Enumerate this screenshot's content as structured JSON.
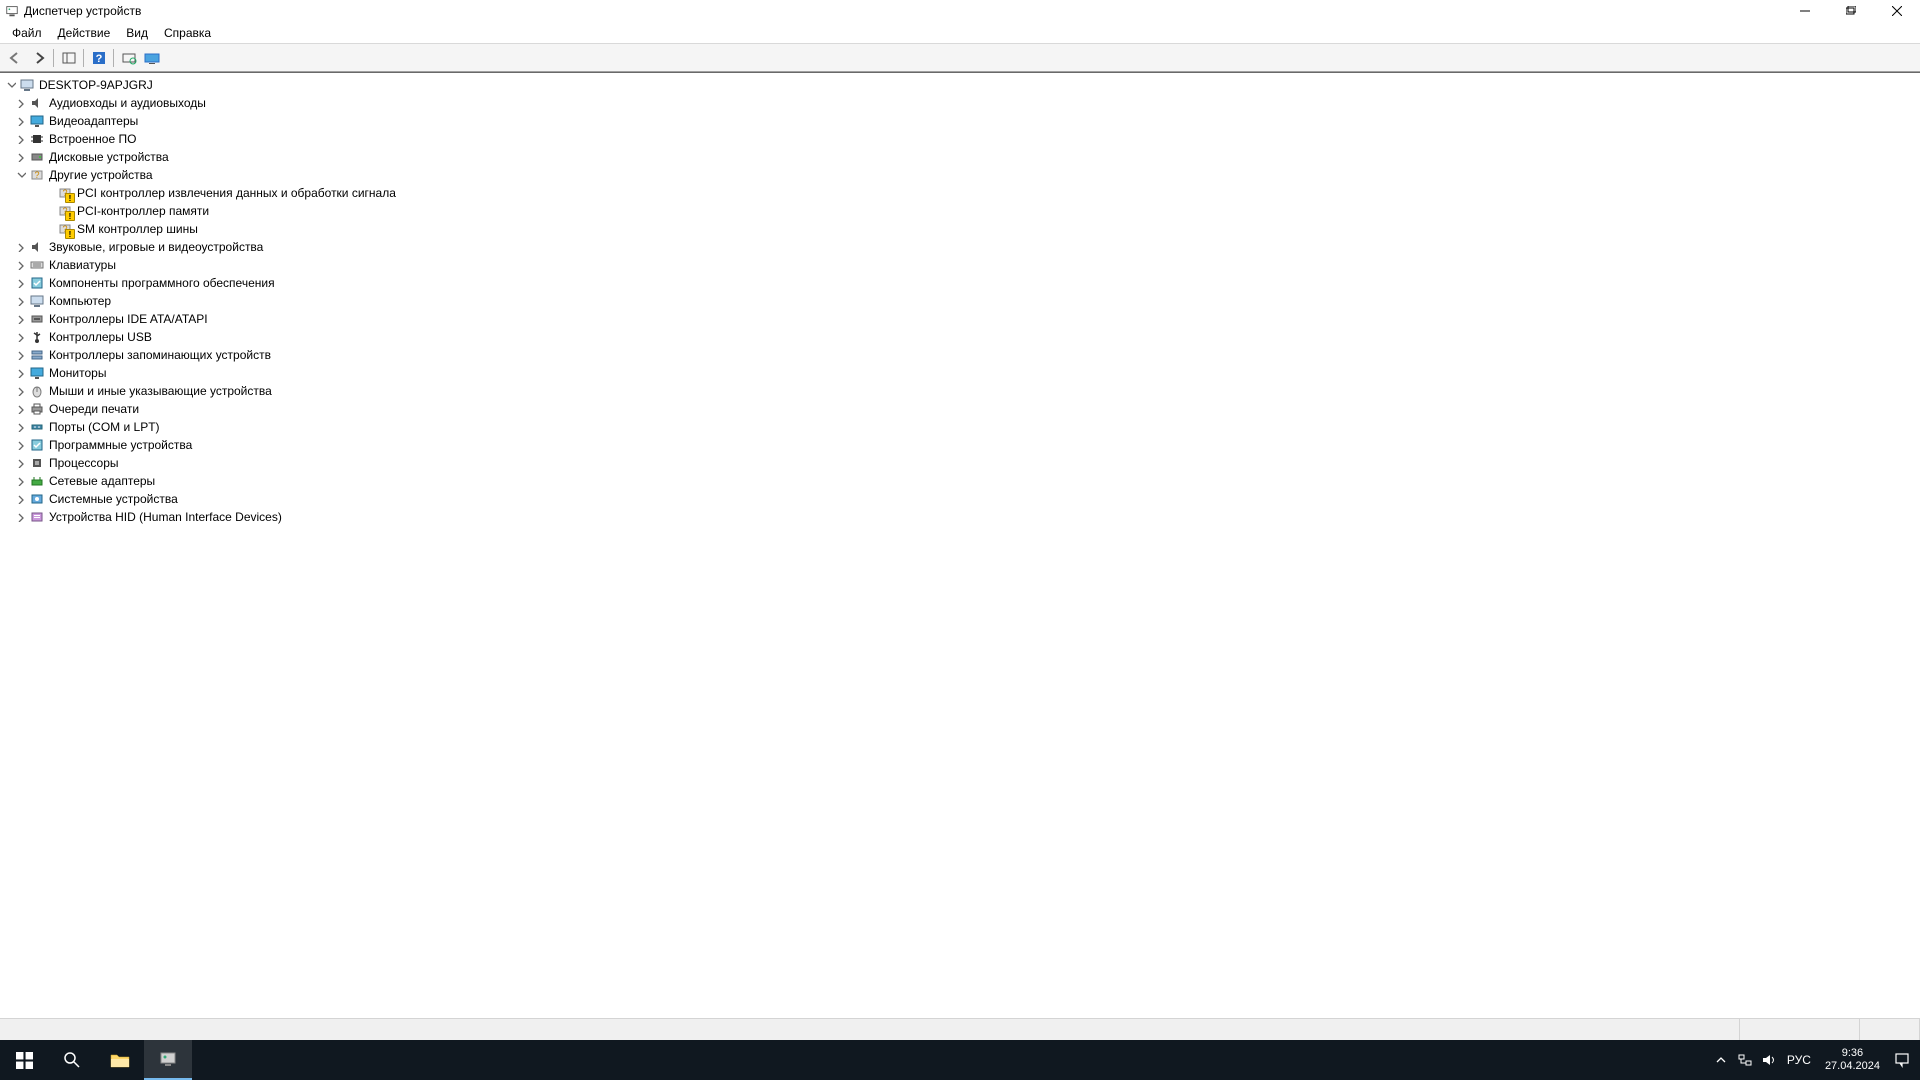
{
  "title": "Диспетчер устройств",
  "menu": {
    "file": "Файл",
    "action": "Действие",
    "view": "Вид",
    "help": "Справка"
  },
  "tree": {
    "root": {
      "label": "DESKTOP-9APJGRJ",
      "expanded": true
    },
    "categories": [
      {
        "id": "audio",
        "label": "Аудиовходы и аудиовыходы",
        "expanded": false,
        "icon": "audio"
      },
      {
        "id": "display",
        "label": "Видеоадаптеры",
        "expanded": false,
        "icon": "monitor"
      },
      {
        "id": "firmware",
        "label": "Встроенное ПО",
        "expanded": false,
        "icon": "chip"
      },
      {
        "id": "disk",
        "label": "Дисковые устройства",
        "expanded": false,
        "icon": "disk"
      },
      {
        "id": "other",
        "label": "Другие устройства",
        "expanded": true,
        "icon": "other",
        "children": [
          {
            "label": "PCI контроллер извлечения данных и обработки сигнала",
            "warning": true
          },
          {
            "label": "PCI-контроллер памяти",
            "warning": true
          },
          {
            "label": "SM контроллер шины",
            "warning": true
          }
        ]
      },
      {
        "id": "sound",
        "label": "Звуковые, игровые и видеоустройства",
        "expanded": false,
        "icon": "audio"
      },
      {
        "id": "keyboard",
        "label": "Клавиатуры",
        "expanded": false,
        "icon": "keyboard"
      },
      {
        "id": "software",
        "label": "Компоненты программного обеспечения",
        "expanded": false,
        "icon": "sw"
      },
      {
        "id": "computer",
        "label": "Компьютер",
        "expanded": false,
        "icon": "pc"
      },
      {
        "id": "ide",
        "label": "Контроллеры IDE ATA/ATAPI",
        "expanded": false,
        "icon": "ide"
      },
      {
        "id": "usb",
        "label": "Контроллеры USB",
        "expanded": false,
        "icon": "usb"
      },
      {
        "id": "storage",
        "label": "Контроллеры запоминающих устройств",
        "expanded": false,
        "icon": "storage"
      },
      {
        "id": "monitors",
        "label": "Мониторы",
        "expanded": false,
        "icon": "monitor"
      },
      {
        "id": "mice",
        "label": "Мыши и иные указывающие устройства",
        "expanded": false,
        "icon": "mouse"
      },
      {
        "id": "printqueue",
        "label": "Очереди печати",
        "expanded": false,
        "icon": "print"
      },
      {
        "id": "ports",
        "label": "Порты (COM и LPT)",
        "expanded": false,
        "icon": "port"
      },
      {
        "id": "softwaredevices",
        "label": "Программные устройства",
        "expanded": false,
        "icon": "sw"
      },
      {
        "id": "cpu",
        "label": "Процессоры",
        "expanded": false,
        "icon": "cpu"
      },
      {
        "id": "network",
        "label": "Сетевые адаптеры",
        "expanded": false,
        "icon": "net"
      },
      {
        "id": "system",
        "label": "Системные устройства",
        "expanded": false,
        "icon": "sys"
      },
      {
        "id": "hid",
        "label": "Устройства HID (Human Interface Devices)",
        "expanded": false,
        "icon": "hid"
      }
    ]
  },
  "tray": {
    "language": "РУС",
    "time": "9:36",
    "date": "27.04.2024"
  }
}
